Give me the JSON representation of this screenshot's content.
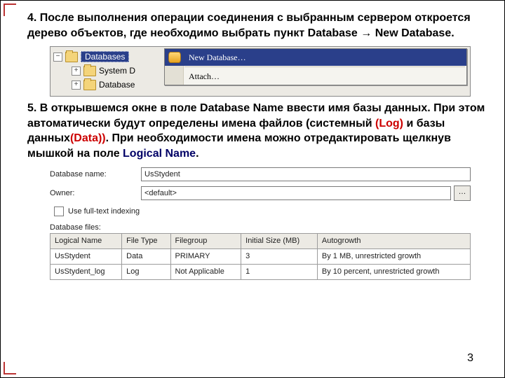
{
  "para4_prefix": "4. После выполнения операции соединения с выбранным сервером откроется дерево объектов, где необходимо выбрать пункт ",
  "para4_db1": "Database",
  "para4_arrow": "→",
  "para4_db2": "New Database.",
  "tree": {
    "root": "Databases",
    "sys": "System D",
    "sub": "Database",
    "minus": "−",
    "plus": "+"
  },
  "menu": {
    "newdb": "New Database…",
    "attach": "Attach…"
  },
  "para5_a": "5. В открывшемся окне в поле ",
  "para5_b": "Database Name",
  "para5_c": " ввести  имя базы данных. При этом автоматически будут определены имена файлов (системный ",
  "para5_log": "(Log)",
  "para5_d": " и базы данных",
  "para5_data": "(Data))",
  "para5_e": ". При необходимости имена можно отредактировать щелкнув мышкой на поле ",
  "para5_ln": "Logical Name",
  "para5_dot": ".",
  "form": {
    "dbname_lbl": "Database name:",
    "dbname_val": "UsStydent",
    "owner_lbl": "Owner:",
    "owner_val": "<default>",
    "dots": "…",
    "fulltext": "Use full-text indexing",
    "files_lbl": "Database files:",
    "cols": {
      "c1": "Logical Name",
      "c2": "File Type",
      "c3": "Filegroup",
      "c4": "Initial Size (MB)",
      "c5": "Autogrowth"
    },
    "row1": {
      "c1": "UsStydent",
      "c2": "Data",
      "c3": "PRIMARY",
      "c4": "3",
      "c5": "By 1 MB, unrestricted growth"
    },
    "row2": {
      "c1": "UsStydent_log",
      "c2": "Log",
      "c3": "Not Applicable",
      "c4": "1",
      "c5": "By 10 percent, unrestricted growth"
    }
  },
  "pagenum": "3"
}
